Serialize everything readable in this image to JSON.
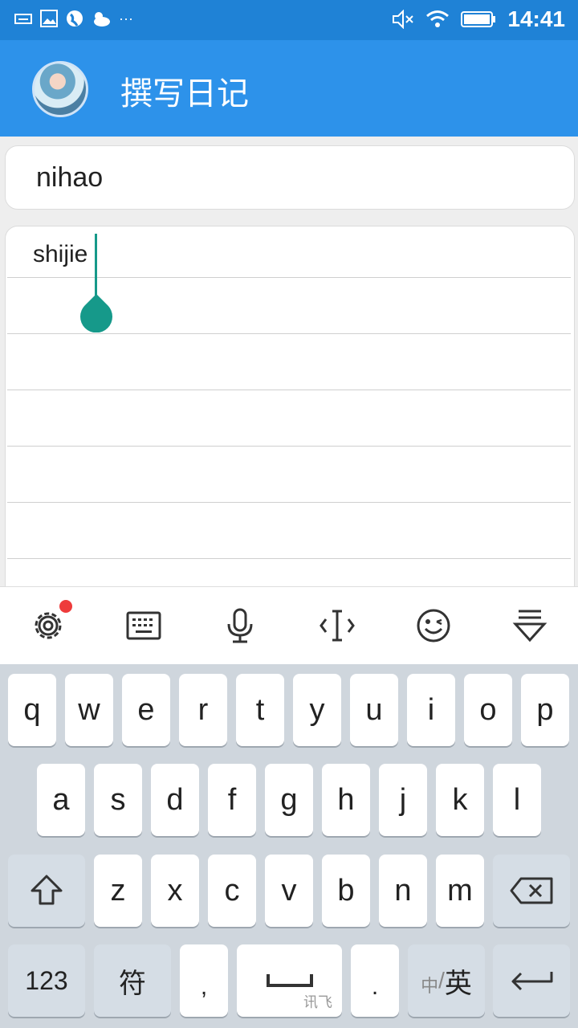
{
  "status": {
    "time": "14:41"
  },
  "app": {
    "title": "撰写日记"
  },
  "editor": {
    "title_value": "nihao",
    "content_value": "shijie"
  },
  "keyboard": {
    "row1": [
      "q",
      "w",
      "e",
      "r",
      "t",
      "y",
      "u",
      "i",
      "o",
      "p"
    ],
    "row2": [
      "a",
      "s",
      "d",
      "f",
      "g",
      "h",
      "j",
      "k",
      "l"
    ],
    "row3": [
      "z",
      "x",
      "c",
      "v",
      "b",
      "n",
      "m"
    ],
    "num_label": "123",
    "symbol_label": "符",
    "comma_label": ",",
    "period_label": ".",
    "space_hint": "讯飞",
    "lang_cn": "中",
    "lang_en": "英"
  },
  "icons": {
    "status_left": [
      "keyboard-icon",
      "image-icon",
      "globe-icon",
      "weather-icon",
      "more-icon"
    ],
    "status_right": [
      "mute-icon",
      "wifi-icon",
      "battery-icon"
    ],
    "toolbar": [
      "settings-icon",
      "keyboard-icon",
      "microphone-icon",
      "cursor-icon",
      "emoji-icon",
      "hide-keyboard-icon"
    ]
  },
  "colors": {
    "appbar": "#2d92ea",
    "statusbar": "#1f82d6",
    "accent": "#16998a",
    "badge": "#ee3b3b"
  }
}
